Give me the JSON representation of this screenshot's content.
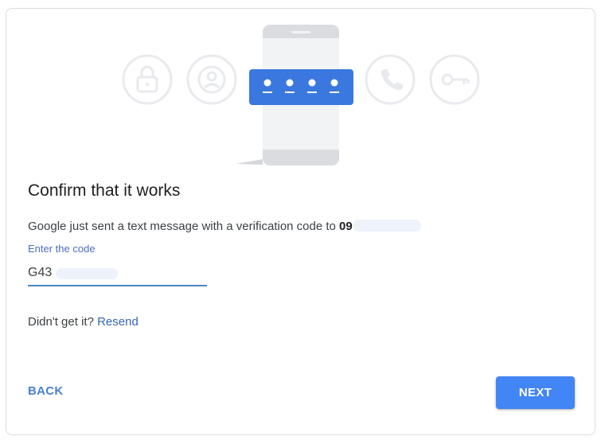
{
  "colors": {
    "accent": "#4285f4",
    "link": "#3367b5",
    "field_underline": "#4a86c8",
    "title_text": "#202124",
    "body_text": "#3c4043",
    "illustration_circle": "#e8eaed",
    "phone_body": "#dadce0",
    "code_banner": "#3a78e0"
  },
  "illustration": {
    "icons": [
      "lock-icon",
      "account-circle-icon",
      "phone-call-icon",
      "key-icon"
    ],
    "phone_code_dots": 4
  },
  "main": {
    "title": "Confirm that it works",
    "description_prefix": "Google just sent a text message with a verification code to ",
    "phone_number_visible": "09"
  },
  "code_field": {
    "label": "Enter the code",
    "value": "G43"
  },
  "resend": {
    "prompt": "Didn't get it?",
    "link": "Resend"
  },
  "actions": {
    "back_label": "BACK",
    "next_label": "NEXT"
  }
}
